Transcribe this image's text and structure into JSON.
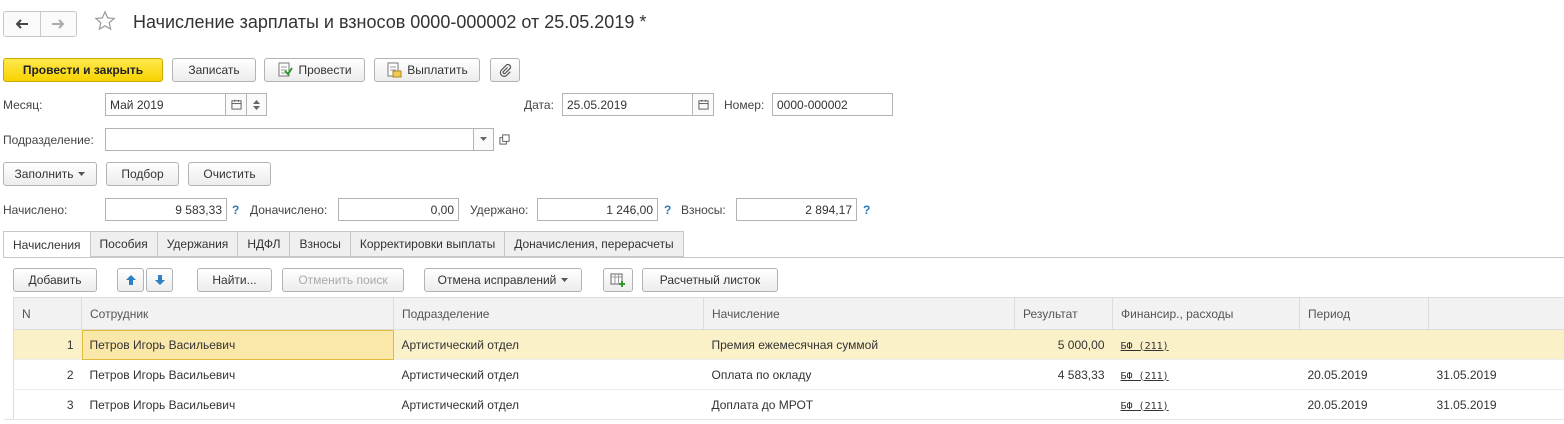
{
  "header": {
    "title": "Начисление зарплаты и взносов 0000-000002 от 25.05.2019 *"
  },
  "toolbar": {
    "post_close": "Провести и закрыть",
    "save": "Записать",
    "post": "Провести",
    "pay": "Выплатить"
  },
  "form": {
    "month_label": "Месяц:",
    "month_value": "Май 2019",
    "date_label": "Дата:",
    "date_value": "25.05.2019",
    "number_label": "Номер:",
    "number_value": "0000-000002",
    "division_label": "Подразделение:",
    "division_value": ""
  },
  "actions": {
    "fill": "Заполнить",
    "select": "Подбор",
    "clear": "Очистить"
  },
  "totals": {
    "accrued_label": "Начислено:",
    "accrued_value": "9 583,33",
    "additional_label": "Доначислено:",
    "additional_value": "0,00",
    "withheld_label": "Удержано:",
    "withheld_value": "1 246,00",
    "contributions_label": "Взносы:",
    "contributions_value": "2 894,17",
    "help": "?"
  },
  "tabs": [
    {
      "label": "Начисления",
      "active": true
    },
    {
      "label": "Пособия"
    },
    {
      "label": "Удержания"
    },
    {
      "label": "НДФЛ"
    },
    {
      "label": "Взносы"
    },
    {
      "label": "Корректировки выплаты"
    },
    {
      "label": "Доначисления, перерасчеты"
    }
  ],
  "table_toolbar": {
    "add": "Добавить",
    "find": "Найти...",
    "cancel_search": "Отменить поиск",
    "cancel_corrections": "Отмена исправлений",
    "payslip": "Расчетный листок"
  },
  "table": {
    "columns": [
      "N",
      "Сотрудник",
      "Подразделение",
      "Начисление",
      "Результат",
      "Финансир., расходы",
      "Период",
      ""
    ],
    "rows": [
      {
        "n": "1",
        "employee": "Петров Игорь Васильевич",
        "division": "Артистический отдел",
        "accrual": "Премия ежемесячная суммой",
        "result": "5 000,00",
        "finance": "БФ (211)",
        "period_from": "",
        "period_to": ""
      },
      {
        "n": "2",
        "employee": "Петров Игорь Васильевич",
        "division": "Артистический отдел",
        "accrual": "Оплата по окладу",
        "result": "4 583,33",
        "finance": "БФ (211)",
        "period_from": "20.05.2019",
        "period_to": "31.05.2019"
      },
      {
        "n": "3",
        "employee": "Петров Игорь Васильевич",
        "division": "Артистический отдел",
        "accrual": "Доплата до МРОТ",
        "result": "",
        "finance": "БФ (211)",
        "period_from": "20.05.2019",
        "period_to": "31.05.2019"
      }
    ]
  },
  "colors": {
    "primary_button": "#f7d300",
    "selected_row": "#fbf1c8",
    "help_icon": "#2a7ab8"
  }
}
